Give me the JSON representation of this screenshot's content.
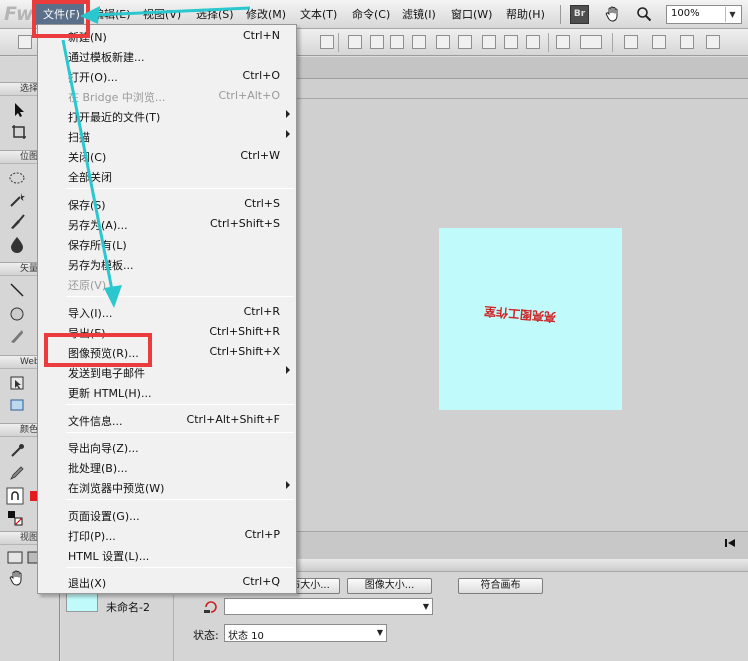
{
  "app": {
    "logo": "Fw",
    "badge": "Br"
  },
  "menubar": {
    "items": [
      "文件(F)",
      "编辑(E)",
      "视图(V)",
      "选择(S)",
      "修改(M)",
      "文本(T)",
      "命令(C)",
      "滤镜(I)",
      "窗口(W)",
      "帮助(H)"
    ],
    "zoom": "100%"
  },
  "file_menu": {
    "items": [
      {
        "label": "新建(N)",
        "shortcut": "Ctrl+N"
      },
      {
        "label": "通过模板新建...",
        "shortcut": ""
      },
      {
        "label": "打开(O)...",
        "shortcut": "Ctrl+O"
      },
      {
        "label": "在 Bridge 中浏览...",
        "shortcut": "Ctrl+Alt+O",
        "disabled": true
      },
      {
        "label": "打开最近的文件(T)",
        "shortcut": "",
        "submenu": true
      },
      {
        "label": "扫描",
        "shortcut": "",
        "submenu": true
      },
      {
        "label": "关闭(C)",
        "shortcut": "Ctrl+W"
      },
      {
        "label": "全部关闭",
        "shortcut": ""
      },
      {
        "label": "保存(S)",
        "shortcut": "Ctrl+S"
      },
      {
        "label": "另存为(A)...",
        "shortcut": "Ctrl+Shift+S"
      },
      {
        "label": "保存所有(L)",
        "shortcut": ""
      },
      {
        "label": "另存为模板...",
        "shortcut": ""
      },
      {
        "label": "还原(V)",
        "shortcut": "",
        "disabled": true
      },
      {
        "label": "导入(I)...",
        "shortcut": "Ctrl+R"
      },
      {
        "label": "导出(E)...",
        "shortcut": "Ctrl+Shift+R"
      },
      {
        "label": "图像预览(R)...",
        "shortcut": "Ctrl+Shift+X"
      },
      {
        "label": "发送到电子邮件",
        "shortcut": "",
        "submenu": true
      },
      {
        "label": "更新 HTML(H)...",
        "shortcut": ""
      },
      {
        "label": "文件信息...",
        "shortcut": "Ctrl+Alt+Shift+F"
      },
      {
        "label": "导出向导(Z)...",
        "shortcut": ""
      },
      {
        "label": "批处理(B)...",
        "shortcut": ""
      },
      {
        "label": "在浏览器中预览(W)",
        "shortcut": "",
        "submenu": true
      },
      {
        "label": "页面设置(G)...",
        "shortcut": ""
      },
      {
        "label": "打印(P)...",
        "shortcut": "Ctrl+P"
      },
      {
        "label": "HTML 设置(L)...",
        "shortcut": ""
      },
      {
        "label": "退出(X)",
        "shortcut": "Ctrl+Q"
      }
    ]
  },
  "tools_panel": {
    "sections": [
      "选择",
      "位图",
      "矢量",
      "Web",
      "颜色",
      "视图"
    ]
  },
  "canvas": {
    "text": "亮亮图工作室",
    "background": "#c0fafa",
    "text_color": "#cf2325"
  },
  "properties": {
    "btn_canvas_size": "画布大小...",
    "btn_image_size": "图像大小...",
    "btn_fit_canvas": "符合画布",
    "doc_name": "未命名-2",
    "state_label": "状态:",
    "state_value": "状态 10"
  },
  "colors": {
    "annotation_red": "#ea3b3d",
    "annotation_cyan": "#2bc7cf",
    "menu_highlight": "#5a6f89"
  }
}
